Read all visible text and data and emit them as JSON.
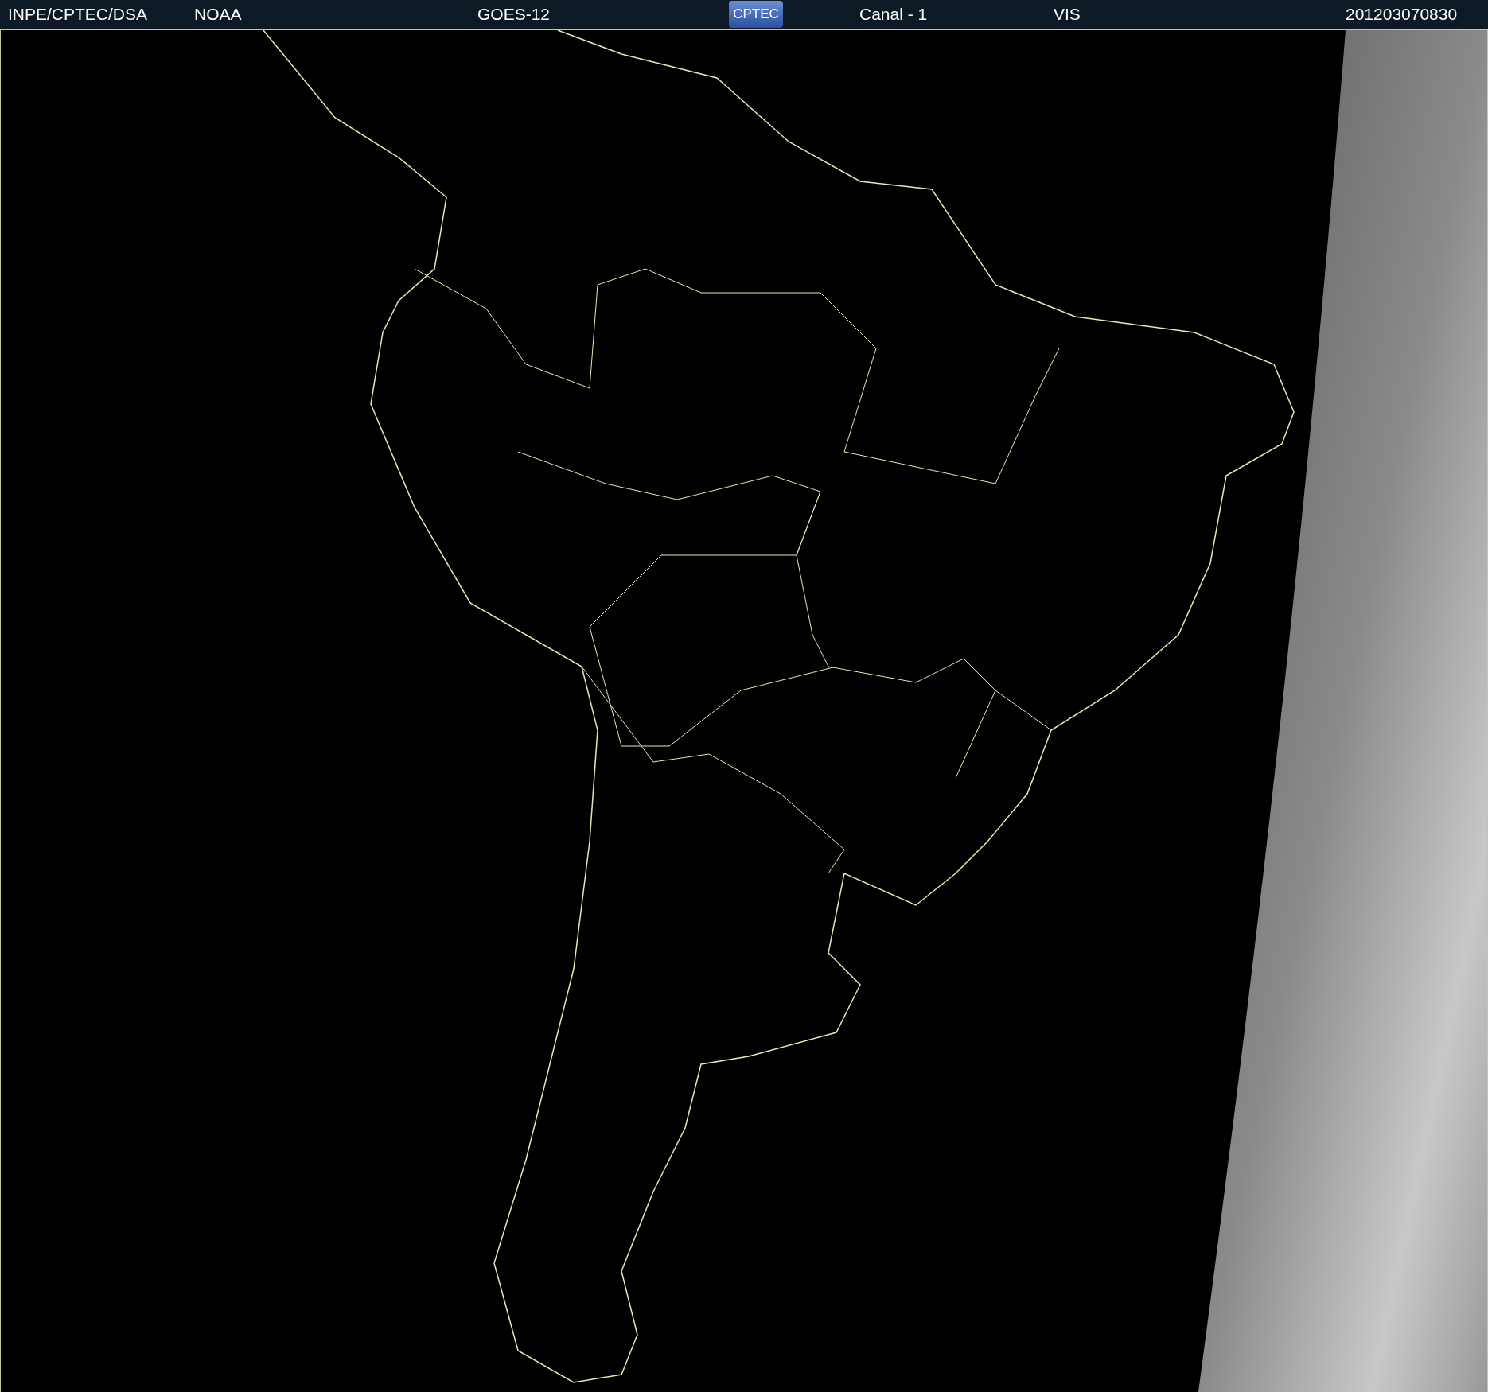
{
  "header": {
    "source": "INPE/CPTEC/DSA",
    "agency": "NOAA",
    "satellite": "GOES-12",
    "logo": "CPTEC",
    "channel": "Canal - 1",
    "band": "VIS",
    "timestamp": "201203070830"
  }
}
